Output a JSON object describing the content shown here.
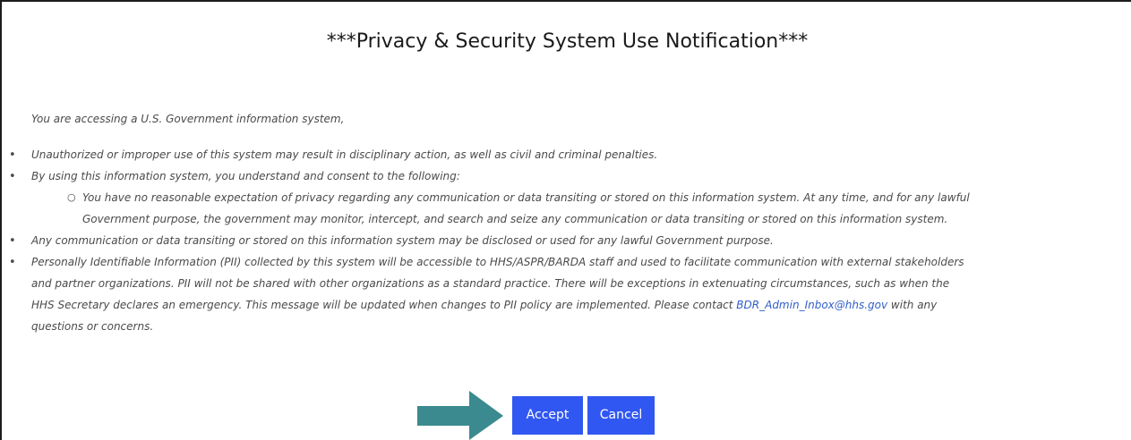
{
  "dialog": {
    "title": "***Privacy & Security System Use Notification***",
    "intro": "You are accessing a U.S. Government information system,",
    "bullets": {
      "b1": "Unauthorized or improper use of this system may result in disciplinary action, as well as civil and criminal penalties.",
      "b2": "By using this information system, you understand and consent to the following:",
      "b2_sub_line1": "You have no reasonable expectation of privacy regarding any communication or data transiting or stored on this information system. At any time, and for any lawful",
      "b2_sub_line2": "Government purpose, the government may monitor, intercept, and search and seize any communication or data transiting or stored on this information system.",
      "b3": "Any communication or data transiting or stored on this information system may be disclosed or used for any lawful Government purpose.",
      "b4_line1": "Personally Identifiable Information (PII) collected by this system will be accessible to HHS/ASPR/BARDA staff and used to facilitate communication with external stakeholders",
      "b4_line2": "and partner organizations.  PII will not be shared with other organizations as a standard practice.  There will be exceptions in extenuating circumstances, such as when the",
      "b4_line3_pre": "HHS Secretary declares an emergency.  This message will be updated when changes to PII policy are implemented.  Please contact ",
      "b4_email": "BDR_Admin_Inbox@hhs.gov",
      "b4_line3_post": " with any",
      "b4_line4": "questions or concerns."
    },
    "buttons": {
      "accept": "Accept",
      "cancel": "Cancel"
    }
  },
  "colors": {
    "button": "#3157f2",
    "link": "#2f5ec9",
    "arrow": "#3b8a8f"
  },
  "icons": {
    "arrow": "right-arrow-icon"
  }
}
